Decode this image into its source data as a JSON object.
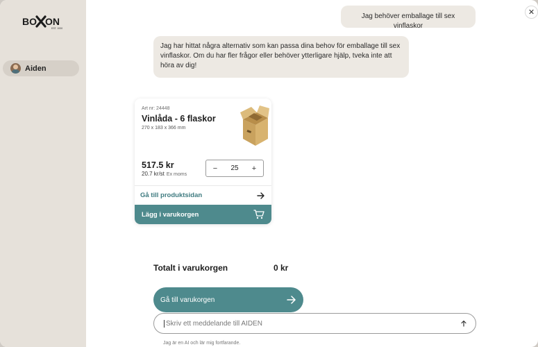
{
  "sidebar": {
    "logo": {
      "text": "BOXON",
      "sub": "EST. 1930"
    },
    "items": [
      {
        "label": "Aiden",
        "icon": "avatar"
      }
    ]
  },
  "chat": {
    "messages": [
      {
        "role": "user",
        "text": "Jag behöver emballage till sex vinflaskor"
      },
      {
        "role": "assistant",
        "text": "Jag har hittat några alternativ som kan passa dina behov för emballage till sex vinflaskor. Om du har fler frågor eller behöver ytterligare hjälp, tveka inte att höra av dig!"
      }
    ]
  },
  "product": {
    "art_nr": "Art nr: 24448",
    "name": "Vinlåda - 6 flaskor",
    "dimensions": "270 x 183 x 366 mm",
    "price": "517.5 kr",
    "price_per": "20.7 kr/st",
    "vat_note": "Ex moms",
    "quantity": "25",
    "link_label": "Gå till produktsidan",
    "add_to_cart_label": "Lägg i varukorgen"
  },
  "cart": {
    "total_label": "Totalt i varukorgen",
    "total_value": "0 kr",
    "go_to_cart_label": "Gå till varukorgen"
  },
  "input": {
    "placeholder": "Skriv ett meddelande till AIDEN",
    "value": ""
  },
  "disclaimer": "Jag är en AI och lär mig fortfarande.",
  "icons": {
    "close": "close-icon",
    "arrow": "arrow-right-icon",
    "cart": "cart-icon",
    "send": "arrow-up-icon"
  },
  "colors": {
    "accent": "#4e8a8d",
    "link": "#3f7b80",
    "sidebar_bg": "#e6e1da",
    "bubble_bg": "#ede9e3"
  }
}
